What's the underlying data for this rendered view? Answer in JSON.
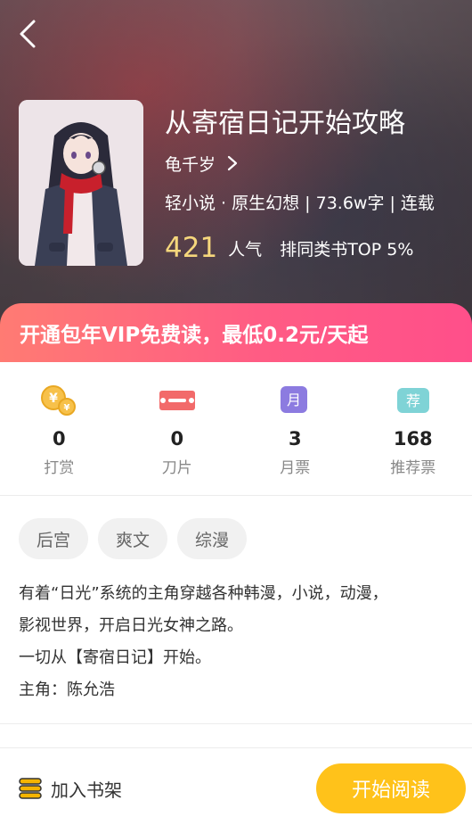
{
  "header": {
    "back_icon": "chevron-left-icon"
  },
  "book": {
    "title": "从寄宿日记开始攻略",
    "author": "龟千岁",
    "meta": "轻小说 · 原生幻想 | 73.6w字 | 连载",
    "popularity_value": "421",
    "popularity_label": "人气",
    "rank_label": "排同类书TOP 5%"
  },
  "vip_banner": {
    "text": "开通包年VIP免费读，最低0.2元/天起"
  },
  "stats": [
    {
      "icon": "coin-icon",
      "value": "0",
      "label": "打赏"
    },
    {
      "icon": "blade-icon",
      "value": "0",
      "label": "刀片"
    },
    {
      "icon": "monthly-ticket-icon",
      "value": "3",
      "label": "月票"
    },
    {
      "icon": "recommend-ticket-icon",
      "value": "168",
      "label": "推荐票"
    }
  ],
  "stat_icon_text": {
    "monthly": "月",
    "recommend": "荐"
  },
  "tags": [
    "后宫",
    "爽文",
    "综漫"
  ],
  "description": [
    "有着“日光”系统的主角穿越各种韩漫，小说，动漫，",
    "影视世界，开启日光女神之路。",
    "一切从【寄宿日记】开始。",
    "主角：陈允浩"
  ],
  "bottom_bar": {
    "shelf_label": "加入书架",
    "read_label": "开始阅读"
  },
  "colors": {
    "vip_gradient_start": "#ff7b73",
    "vip_gradient_end": "#ff4f8a",
    "popularity_number": "#f6d77c",
    "read_button": "#ffc21a"
  }
}
